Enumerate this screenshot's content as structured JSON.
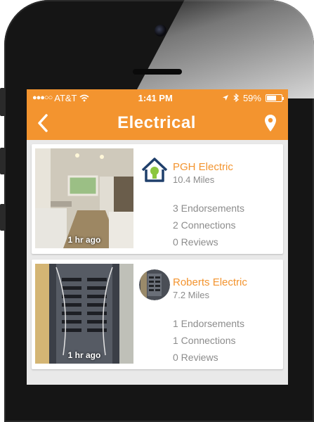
{
  "status": {
    "carrier": "AT&T",
    "time": "1:41 PM",
    "battery": "59%"
  },
  "nav": {
    "title": "Electrical"
  },
  "colors": {
    "accent": "#f3942f"
  },
  "listings": [
    {
      "company": "PGH Electric",
      "miles": "10.4 Miles",
      "endorsements": "3 Endorsements",
      "connections": "2 Connections",
      "reviews": "0 Reviews",
      "posted": "1 hr ago",
      "avatar_icon": "house-bulb-logo",
      "photo": "kitchen-renovation-photo"
    },
    {
      "company": "Roberts Electric",
      "miles": "7.2 Miles",
      "endorsements": "1 Endorsements",
      "connections": "1 Connections",
      "reviews": "0 Reviews",
      "posted": "1 hr ago",
      "avatar_icon": "electrical-panel-avatar",
      "photo": "electrical-panel-photo"
    }
  ]
}
